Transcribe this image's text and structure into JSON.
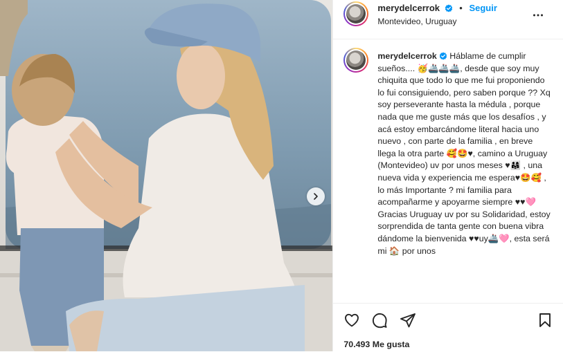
{
  "post": {
    "username": "merydelcerrok",
    "follow_label": "Seguir",
    "location": "Montevideo, Uruguay",
    "caption": "Háblame de cumplir sueños.... 🥳🚢🚢🚢, desde que soy muy chiquita que todo lo que me fui proponiendo lo fui consiguiendo, pero saben porque ?? Xq soy perseverante hasta la médula , porque nada que me guste más que los desafíos , y acá estoy embarcándome literal hacia uno nuevo , con parte de la familia , en breve llega la otra parte 🥰🤩♥, camino a Uruguay (Montevideo) uv por unos meses ♥👨‍👩‍👧 , una nueva vida y experiencia me espera♥🤩🥰 , lo más Importante ? mi familia para acompañarme y apoyarme siempre ♥♥🩷\nGracias Uruguay uv por su Solidaridad, estoy sorprendida de tanta gente con buena vibra dándome la bienvenida ♥♥uy🚢🩷, esta será mi 🏠 por unos",
    "likes": "70.493 Me gusta"
  },
  "icons": {
    "verified": "verified-badge-icon",
    "more": "more-options-icon",
    "like": "heart-icon",
    "comment": "comment-icon",
    "share": "paper-plane-icon",
    "save": "bookmark-icon",
    "next": "chevron-right-icon"
  },
  "colors": {
    "link": "#0095f6",
    "verified": "#0095f6",
    "text": "#262626",
    "divider": "#efefef"
  }
}
